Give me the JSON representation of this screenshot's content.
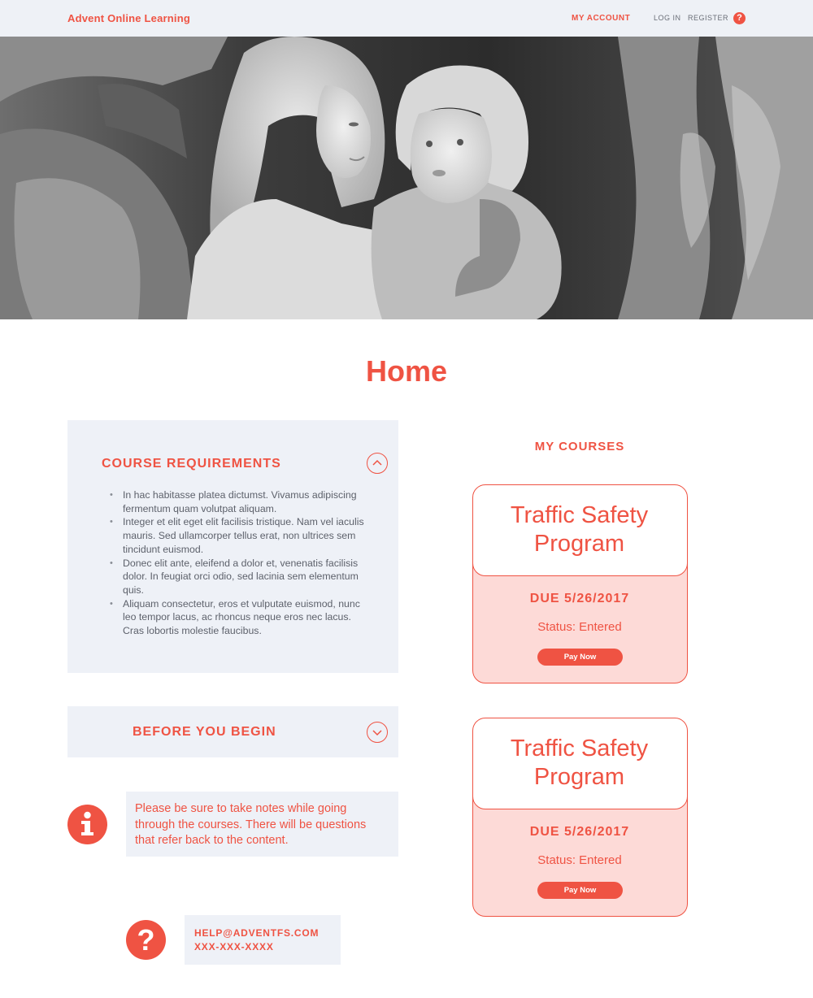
{
  "header": {
    "brand": "Advent Online Learning",
    "nav": {
      "my_account": "MY ACCOUNT",
      "log_in": "LOG IN",
      "register": "REGISTER",
      "help_glyph": "?"
    }
  },
  "page": {
    "title": "Home"
  },
  "course_requirements": {
    "title": "COURSE REQUIREMENTS",
    "items": [
      "In hac habitasse platea dictumst. Vivamus adipiscing fermentum quam volutpat aliquam.",
      "Integer et elit eget elit facilisis tristique. Nam vel iaculis mauris. Sed ullamcorper tellus erat, non ultrices sem tincidunt euismod.",
      "Donec elit ante, eleifend a dolor et, venenatis facilisis dolor. In feugiat orci odio, sed lacinia sem elementum quis.",
      "Aliquam consectetur, eros et vulputate euismod, nunc leo tempor lacus, ac rhoncus neque eros nec lacus. Cras lobortis molestie faucibus."
    ]
  },
  "before_you_begin": {
    "title": "BEFORE YOU BEGIN"
  },
  "note": {
    "text": "Please be sure to take notes while going through the courses. There will be questions that refer back to the content."
  },
  "contact": {
    "email": "HELP@ADVENTFS.COM",
    "phone": "XXX-XXX-XXXX",
    "help_glyph": "?"
  },
  "my_courses": {
    "heading": "MY COURSES",
    "courses": [
      {
        "name_line1": "Traffic Safety",
        "name_line2": "Program",
        "due": "DUE 5/26/2017",
        "status": "Status: Entered",
        "button": "Pay Now"
      },
      {
        "name_line1": "Traffic Safety",
        "name_line2": "Program",
        "due": "DUE 5/26/2017",
        "status": "Status: Entered",
        "button": "Pay Now"
      }
    ]
  },
  "colors": {
    "accent": "#ef5343",
    "panel_bg": "#eef1f7",
    "card_bg": "#fddad7"
  },
  "icons": {
    "hero": "hero-photo-mother-child",
    "expand": "chevron-up-circle-icon",
    "collapse": "chevron-down-circle-icon",
    "info": "info-icon",
    "help": "question-icon"
  }
}
